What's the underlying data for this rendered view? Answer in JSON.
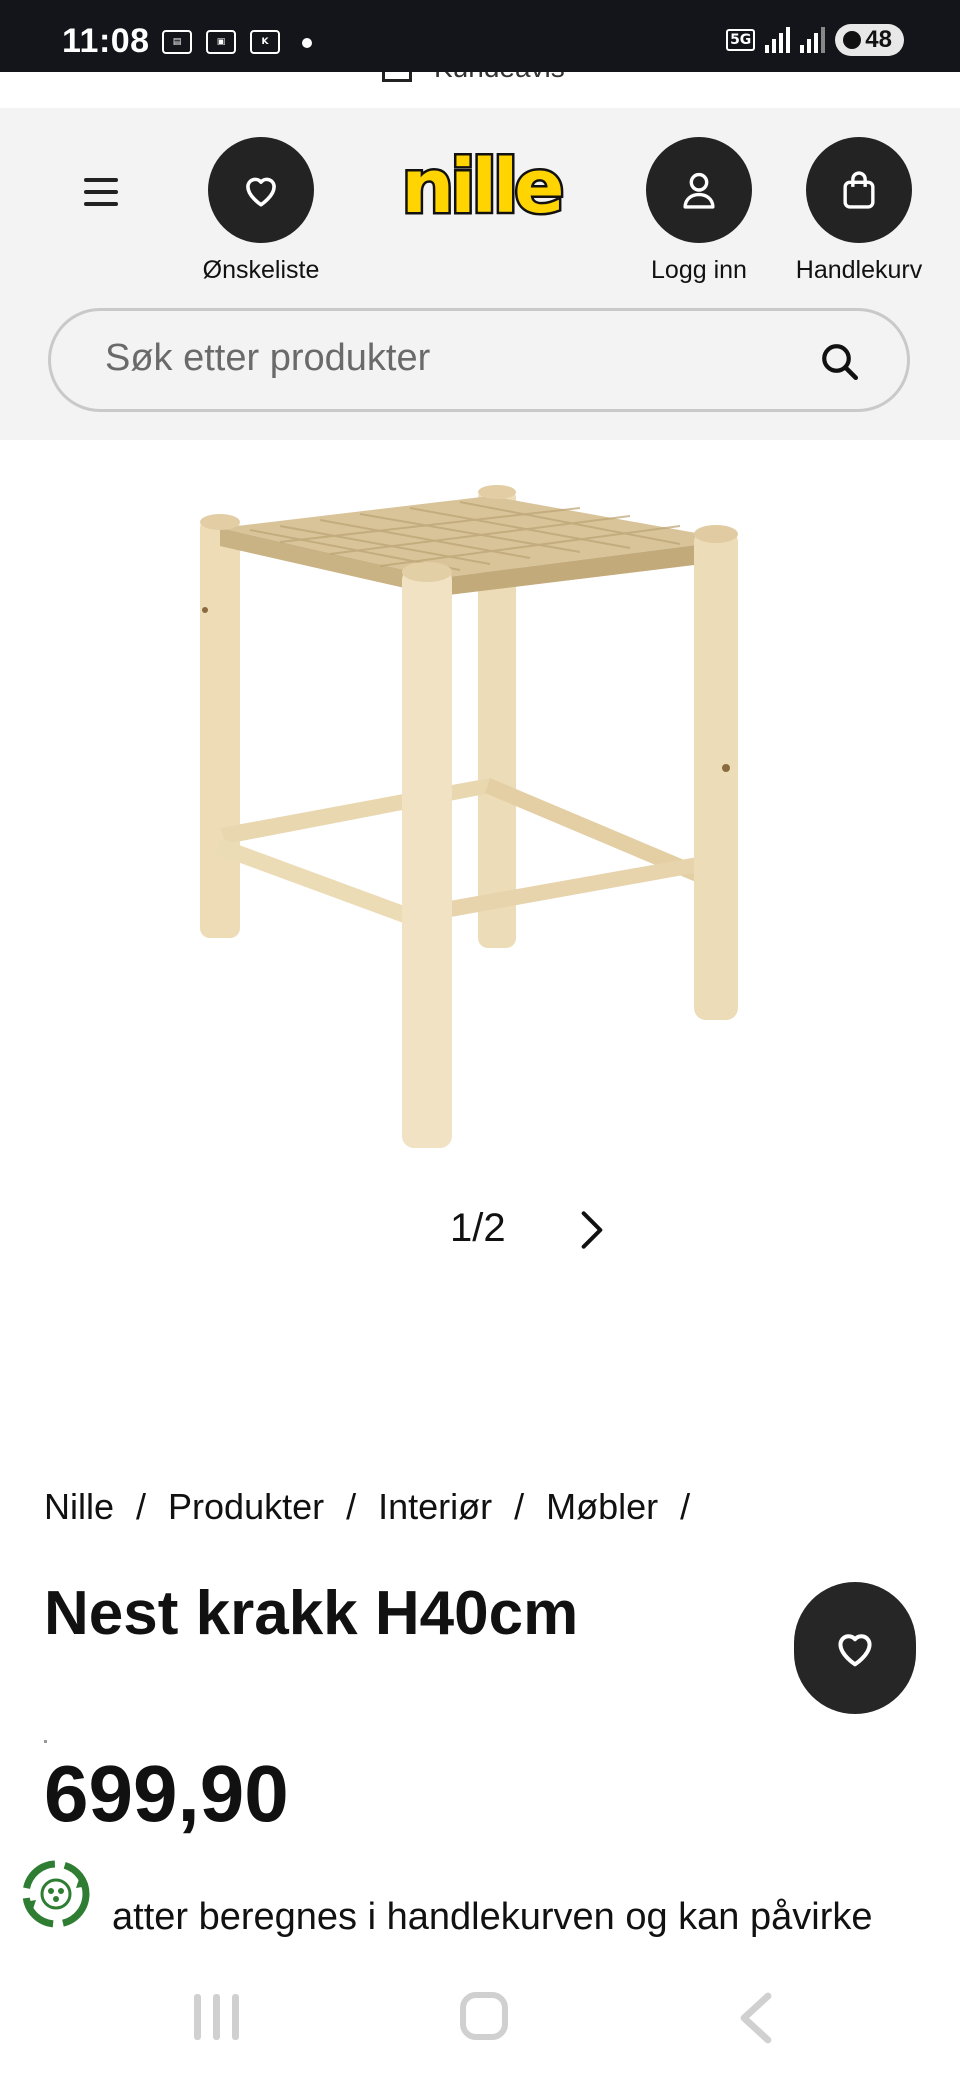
{
  "status_bar": {
    "time": "11:08",
    "notification_icons": [
      "news-icon",
      "screenshot-icon",
      "kundeavis-app-icon"
    ],
    "network": "5G",
    "battery": "48"
  },
  "top_strip": {
    "kundeavis_label": "Kundeavis"
  },
  "header": {
    "logo_text": "nille",
    "wishlist_label": "Ønskeliste",
    "login_label": "Logg inn",
    "cart_label": "Handlekurv",
    "search_placeholder": "Søk etter produkter"
  },
  "gallery": {
    "pager": "1/2"
  },
  "breadcrumb": [
    "Nille",
    "Produkter",
    "Interiør",
    "Møbler"
  ],
  "product": {
    "title": "Nest krakk H40cm",
    "price": "699,90",
    "notice": "atter beregnes i handlekurven og kan påvirke"
  },
  "colors": {
    "brand_yellow": "#ffd400",
    "dark_button": "#232323",
    "header_bg": "#f3f3f3",
    "recycle_green": "#2e7d32"
  }
}
